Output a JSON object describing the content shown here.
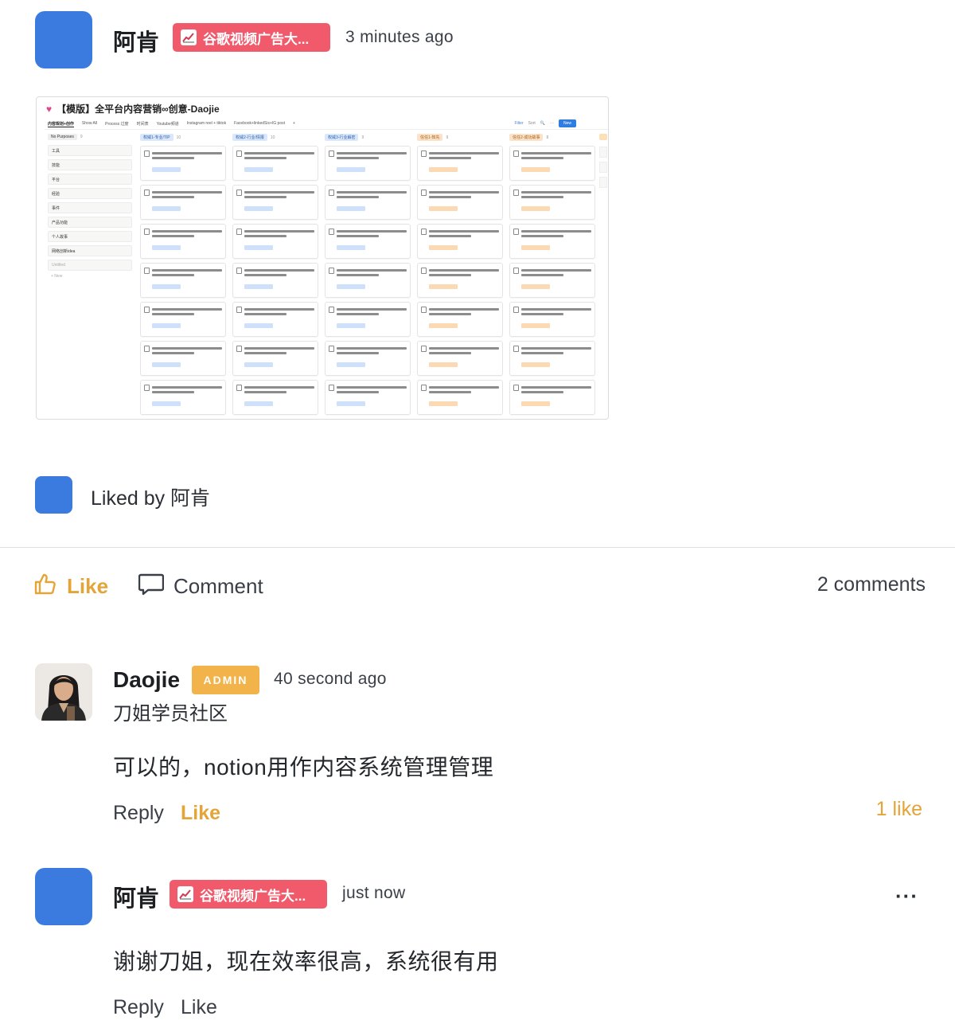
{
  "post": {
    "author": "阿肯",
    "badge": "谷歌视频广告大...",
    "timestamp": "3 minutes ago",
    "attachment": {
      "title": "【模版】全平台内容营销∞创意-Daojie",
      "views": [
        "内容规划+创作",
        "Show All",
        "Process 过度",
        "时间表",
        "Youtube频道",
        "Instagram reel + tiktok",
        "Facebook+linkedSix+IG post",
        "+"
      ],
      "toolbar": [
        "Filter",
        "Sort",
        "🔍",
        "···"
      ],
      "new_label": "New",
      "sidebar_header": "No Purposes",
      "sidebar_count": "9",
      "sidebar_items": [
        "工具",
        "技能",
        "平台",
        "经验",
        "事件",
        "产品功能",
        "个人故事",
        "网络创新idea",
        "Untitled"
      ],
      "sidebar_add": "+ New",
      "columns": [
        {
          "label": "权威1-专业/TIP",
          "count": "10"
        },
        {
          "label": "权威2-行业/情报",
          "count": "10"
        },
        {
          "label": "权威3-行业解密",
          "count": "9"
        },
        {
          "label": "信任1-知先",
          "count": "9"
        },
        {
          "label": "信任2-成功故事",
          "count": "8"
        }
      ],
      "column_add": "+ New"
    },
    "liked_by": "Liked by 阿肯"
  },
  "actions": {
    "like_label": "Like",
    "comment_label": "Comment",
    "comments_count": "2 comments"
  },
  "comments": [
    {
      "author": "Daojie",
      "badge": "ADMIN",
      "timestamp": "40 second ago",
      "group": "刀姐学员社区",
      "body": "可以的，notion用作内容系统管理管理",
      "reply_label": "Reply",
      "like_label": "Like",
      "likes": "1 like"
    },
    {
      "author": "阿肯",
      "badge": "谷歌视频广告大...",
      "timestamp": "just now",
      "body": "谢谢刀姐，现在效率很高，系统很有用",
      "reply_label": "Reply",
      "like_label": "Like",
      "more": "···"
    }
  ],
  "colors": {
    "avatar_blue": "#3b7be0",
    "badge_red": "#f05a6b",
    "admin_orange": "#f1b34a",
    "like_orange": "#e4a437"
  }
}
